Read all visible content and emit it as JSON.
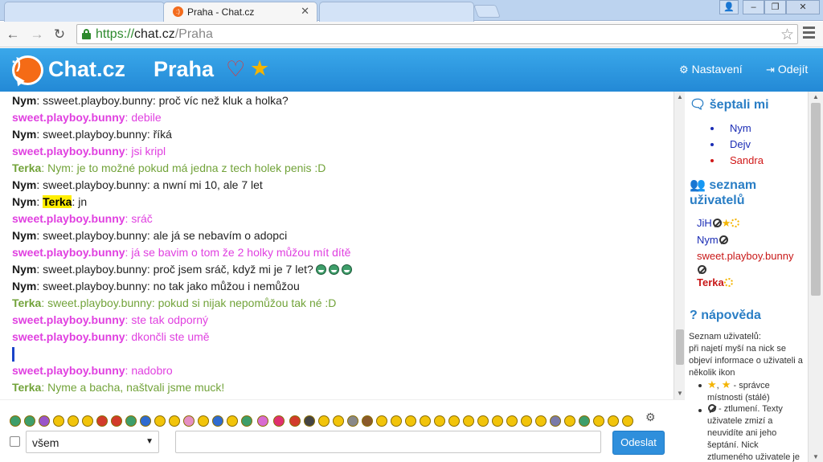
{
  "browser": {
    "tabs": [
      {
        "title": "",
        "state": "inactive"
      },
      {
        "title": "Praha - Chat.cz",
        "state": "active"
      },
      {
        "title": "",
        "state": "inactive"
      }
    ],
    "url": {
      "scheme": "https://",
      "host": "chat.cz",
      "path": "/Praha"
    }
  },
  "header": {
    "brand": "Chat.cz",
    "room": "Praha",
    "settings_label": "Nastavení",
    "logout_label": "Odejít"
  },
  "messages": [
    {
      "nick": "Nym",
      "user": "nym",
      "text": "ssweet.playboy.bunny: proč víc než kluk a holka?"
    },
    {
      "nick": "sweet.playboy.bunny",
      "user": "sweet",
      "text": "debile"
    },
    {
      "nick": "Nym",
      "user": "nym",
      "text": "sweet.playboy.bunny: říká"
    },
    {
      "nick": "sweet.playboy.bunny",
      "user": "sweet",
      "text": "jsi kripl"
    },
    {
      "nick": "Terka",
      "user": "terka",
      "text": "Nym: je to možné pokud má jedna z tech holek penis :D"
    },
    {
      "nick": "Nym",
      "user": "nym",
      "text": "sweet.playboy.bunny: a nwní mi 10, ale 7 let"
    },
    {
      "nick": "Nym",
      "user": "nym",
      "mention": "Terka",
      "text": ": jn"
    },
    {
      "nick": "sweet.playboy.bunny",
      "user": "sweet",
      "text": "sráč"
    },
    {
      "nick": "Nym",
      "user": "nym",
      "text": "sweet.playboy.bunny: ale já se nebavím o adopci"
    },
    {
      "nick": "sweet.playboy.bunny",
      "user": "sweet",
      "text": "já se bavim o tom že 2 holky můžou mít dítě"
    },
    {
      "nick": "Nym",
      "user": "nym",
      "text": "sweet.playboy.bunny: proč jsem sráč, když mi je 7 let?",
      "emoticons": 3
    },
    {
      "nick": "Nym",
      "user": "nym",
      "text": "sweet.playboy.bunny: no tak jako můžou i nemůžou"
    },
    {
      "nick": "Terka",
      "user": "terka",
      "text": "sweet.playboy.bunny: pokud si nijak nepomůžou tak né :D"
    },
    {
      "nick": "sweet.playboy.bunny",
      "user": "sweet",
      "text": "ste tak odporný"
    },
    {
      "nick": "sweet.playboy.bunny",
      "user": "sweet",
      "text": "dkončli ste umě"
    },
    {
      "nick": "sweet.playboy.bunny",
      "user": "sweet",
      "text": "nadobro"
    },
    {
      "nick": "Terka",
      "user": "terka",
      "text": "Nyme a bacha, naštvali jsme muck!"
    }
  ],
  "sidebar": {
    "whispers_title": "šeptali mi",
    "whispers": [
      {
        "name": "Nym",
        "color": "#1a2cb5"
      },
      {
        "name": "Dejv",
        "color": "#1a2cb5"
      },
      {
        "name": "Sandra",
        "color": "#d01818"
      }
    ],
    "users_title": "seznam uživatelů",
    "users": [
      {
        "name": "JiH",
        "color": "#1a2cb5",
        "icons": [
          "muted",
          "star",
          "sun"
        ]
      },
      {
        "name": "Nym",
        "color": "#1a2cb5",
        "icons": [
          "muted"
        ]
      },
      {
        "name": "sweet.playboy.bunny",
        "color": "#c81818",
        "icons": [
          "muted"
        ]
      },
      {
        "name": "Terka",
        "color": "#c81818",
        "bold": true,
        "icons": [
          "sun"
        ]
      }
    ],
    "help_title": "nápověda",
    "help_intro": "Seznam uživatelů:",
    "help_text": "při najetí myší na nick se objeví informace o uživateli a několik ikon",
    "help_items": [
      " - správce místnosti (stálé)",
      " - ztlumení. Texty uživatele zmizí a neuvidíte ani jeho šeptání. Nick ztlumeného uživatele je přeškrtnutý"
    ]
  },
  "input": {
    "recipient": "všem",
    "message_value": "",
    "send_label": "Odeslat"
  },
  "colors": {
    "header_blue": "#2389d6",
    "nym": "#1a1a1a",
    "sweet": "#e040e0",
    "terka": "#72a33a",
    "send_button": "#2f8fdc"
  }
}
